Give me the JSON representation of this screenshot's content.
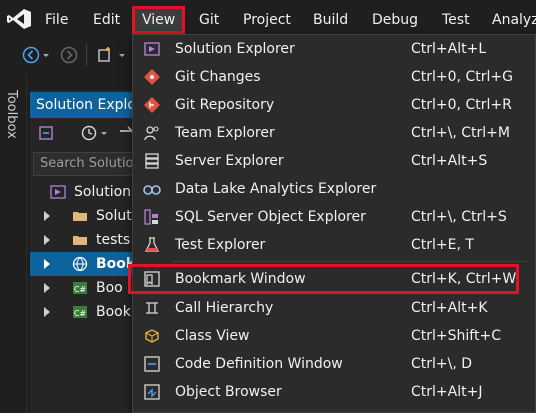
{
  "menubar": {
    "items": [
      "File",
      "Edit",
      "View",
      "Git",
      "Project",
      "Build",
      "Debug",
      "Test",
      "Analyz"
    ],
    "active": "View"
  },
  "toolbox": {
    "label": "Toolbox"
  },
  "solution_explorer": {
    "title": "Solution Explor",
    "search_placeholder": "Search Solutio",
    "tree": [
      {
        "label": "Solution",
        "icon": "solution-icon",
        "expandable": false,
        "selected": false
      },
      {
        "label": "Solut",
        "icon": "folder-icon",
        "expandable": true,
        "selected": false
      },
      {
        "label": "tests",
        "icon": "folder-icon",
        "expandable": true,
        "selected": false
      },
      {
        "label": "Book",
        "icon": "web-project-icon",
        "expandable": true,
        "selected": true
      },
      {
        "label": "Boo",
        "icon": "csharp-project-icon",
        "expandable": true,
        "selected": false
      },
      {
        "label": "Book",
        "icon": "csharp-project-icon",
        "expandable": true,
        "selected": false
      }
    ]
  },
  "view_menu": {
    "items": [
      {
        "label": "Solution Explorer",
        "shortcut": "Ctrl+Alt+L",
        "icon": "solution-explorer-icon"
      },
      {
        "label": "Git Changes",
        "shortcut": "Ctrl+0, Ctrl+G",
        "icon": "git-changes-icon"
      },
      {
        "label": "Git Repository",
        "shortcut": "Ctrl+0, Ctrl+R",
        "icon": "git-repository-icon"
      },
      {
        "label": "Team Explorer",
        "shortcut": "Ctrl+\\, Ctrl+M",
        "icon": "team-explorer-icon"
      },
      {
        "label": "Server Explorer",
        "shortcut": "Ctrl+Alt+S",
        "icon": "server-explorer-icon"
      },
      {
        "label": "Data Lake Analytics Explorer",
        "shortcut": "",
        "icon": "data-lake-icon"
      },
      {
        "label": "SQL Server Object Explorer",
        "shortcut": "Ctrl+\\, Ctrl+S",
        "icon": "sql-server-icon"
      },
      {
        "label": "Test Explorer",
        "shortcut": "Ctrl+E, T",
        "icon": "test-explorer-icon"
      },
      {
        "label": "Bookmark Window",
        "shortcut": "Ctrl+K, Ctrl+W",
        "icon": "bookmark-window-icon"
      },
      {
        "label": "Call Hierarchy",
        "shortcut": "Ctrl+Alt+K",
        "icon": "call-hierarchy-icon"
      },
      {
        "label": "Class View",
        "shortcut": "Ctrl+Shift+C",
        "icon": "class-view-icon"
      },
      {
        "label": "Code Definition Window",
        "shortcut": "Ctrl+\\, D",
        "icon": "code-definition-icon"
      },
      {
        "label": "Object Browser",
        "shortcut": "Ctrl+Alt+J",
        "icon": "object-browser-icon"
      }
    ]
  },
  "colors": {
    "accent": "#0e639c",
    "highlight_border": "#e81123",
    "menu_bg": "#2b2b2b",
    "app_bg": "#1f1f1f"
  }
}
